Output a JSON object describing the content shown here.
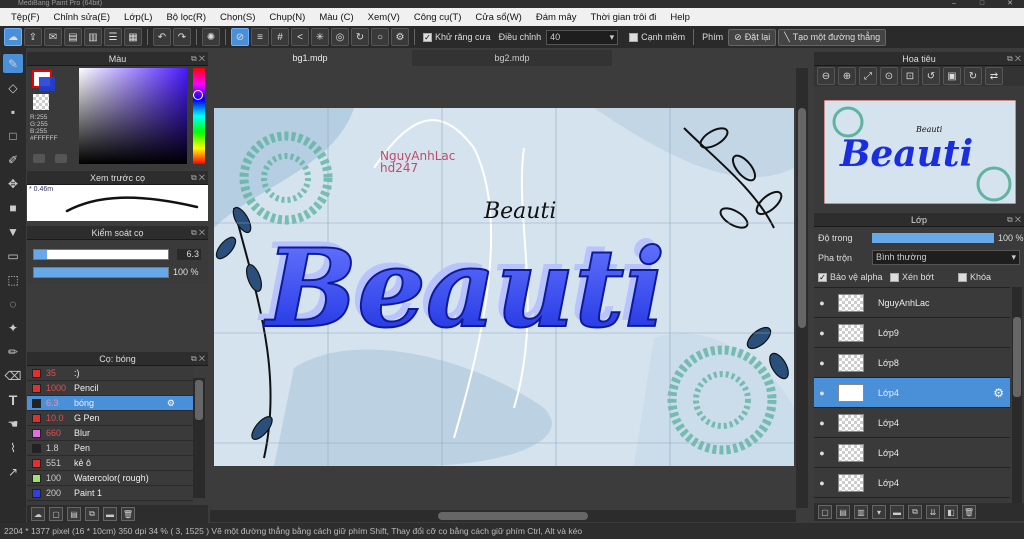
{
  "window": {
    "title": "MediBang Paint Pro (64bit)"
  },
  "menu": [
    "Tệp(F)",
    "Chỉnh sửa(E)",
    "Lớp(L)",
    "Bộ lọc(R)",
    "Chọn(S)",
    "Chụp(N)",
    "Màu (C)",
    "Xem(V)",
    "Công cụ(T)",
    "Cửa sổ(W)",
    "Đám mây",
    "Thời gian trôi đi",
    "Help"
  ],
  "toolbar": {
    "antialias_label": "Khử răng cưa",
    "adjust_label": "Điều chỉnh",
    "adjust_value": "40",
    "edge_label": "Cạnh mềm",
    "key_label": "Phím",
    "reset_label": "Đặt lại",
    "line_label": "Tạo một đường thẳng"
  },
  "color_panel": {
    "title": "Màu",
    "r": "R:255",
    "g": "G:255",
    "b": "B:255",
    "hex": "#FFFFFF"
  },
  "preview_panel": {
    "title": "Xem trước cọ",
    "size": "0.46m"
  },
  "brush_control": {
    "title": "Kiểm soát cọ",
    "size_value": "6.3",
    "opacity_value": "100 %",
    "size_fraction": 0.1,
    "opacity_fraction": 1.0
  },
  "brush_panel": {
    "title": "Cọ: bóng",
    "items": [
      {
        "size": "35",
        "name": ":)",
        "color": "#e03030"
      },
      {
        "size": "1000",
        "name": "Pencil",
        "color": "#e03030"
      },
      {
        "size": "6.3",
        "name": "bóng",
        "color": "#222222"
      },
      {
        "size": "10.0",
        "name": "G Pen",
        "color": "#e03030"
      },
      {
        "size": "660",
        "name": "Blur",
        "color": "#e070e0"
      },
      {
        "size": "1.8",
        "name": "Pen",
        "color": "#222222"
      },
      {
        "size": "551",
        "name": "kẻ ô",
        "color": "#e03030"
      },
      {
        "size": "100",
        "name": "Watercolor( rough)",
        "color": "#a0e070"
      },
      {
        "size": "200",
        "name": "Paint 1",
        "color": "#3040e0"
      }
    ]
  },
  "tabs": [
    "bg1.mdp",
    "bg2.mdp"
  ],
  "canvas": {
    "watermark_line1": "NguyAnhLac",
    "watermark_line2": "hd247",
    "small_word": "Beauti",
    "big_word": "Beauti"
  },
  "navigator": {
    "title": "Hoa tiêu",
    "small_word": "Beauti",
    "big_word": "Beauti"
  },
  "layers_panel": {
    "title": "Lớp",
    "opacity_label": "Độ trong",
    "opacity_value": "100 %",
    "opacity_fraction": 1.0,
    "blend_label": "Pha trộn",
    "blend_value": "Bình thường",
    "protect_alpha": "Bảo vệ alpha",
    "clipping": "Xén bớt",
    "lock": "Khóa",
    "layers": [
      {
        "name": "NguyAnhLac"
      },
      {
        "name": "Lớp9"
      },
      {
        "name": "Lớp8"
      },
      {
        "name": "Lớp4"
      },
      {
        "name": "Lớp4"
      },
      {
        "name": "Lớp4"
      },
      {
        "name": "Lớp4"
      }
    ]
  },
  "status": {
    "text": "2204 * 1377 pixel  (16 * 10cm)  350 dpi   34 %   ( 3, 1525 )   Vẽ một đường thẳng bằng cách giữ phím Shift, Thay đổi cỡ cọ bằng cách giữ phím Ctrl, Alt và kéo"
  }
}
